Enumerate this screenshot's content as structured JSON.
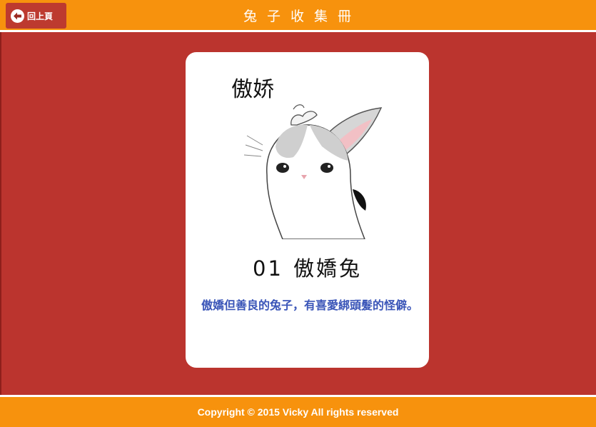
{
  "header": {
    "back_label": "回上頁",
    "title": "兔子收集冊"
  },
  "card": {
    "image_caption": "傲娇",
    "number": "01",
    "name": "傲嬌兔",
    "description": "傲嬌但善良的兔子，有喜愛綁頭髮的怪僻。"
  },
  "footer": {
    "copyright": "Copyright © 2015 Vicky All rights reserved"
  },
  "colors": {
    "header_bg": "#f7920d",
    "main_bg": "#bb342e",
    "back_button_bg": "#bd3a2f",
    "description_text": "#3a55b8"
  }
}
